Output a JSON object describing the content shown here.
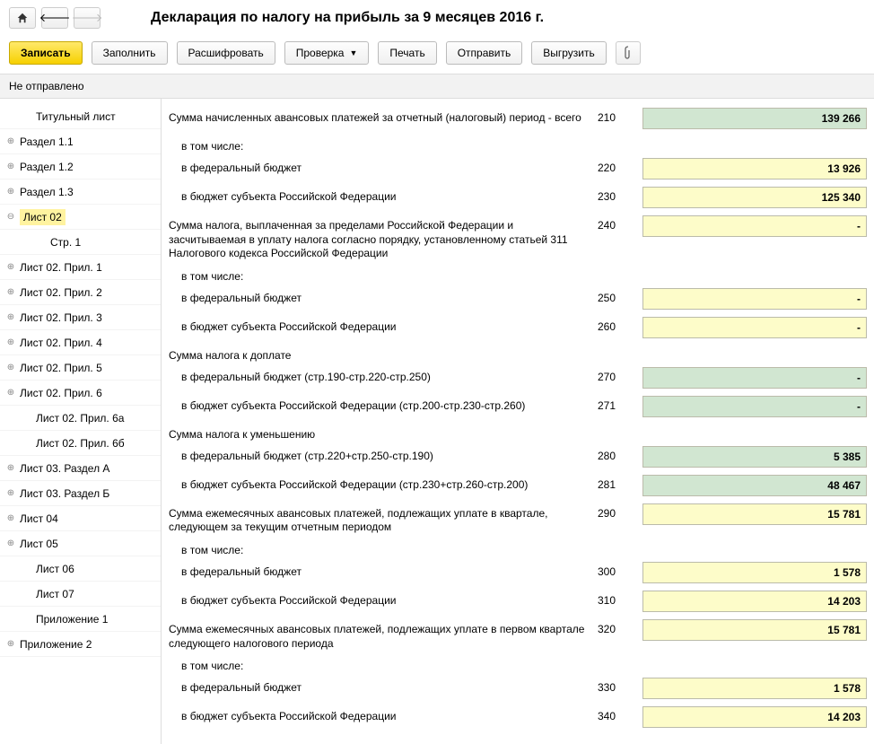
{
  "header": {
    "title": "Декларация по налогу на прибыль за 9 месяцев 2016 г."
  },
  "toolbar": {
    "save": "Записать",
    "fill": "Заполнить",
    "decode": "Расшифровать",
    "check": "Проверка",
    "print": "Печать",
    "send": "Отправить",
    "export": "Выгрузить"
  },
  "status": "Не отправлено",
  "sidebar": [
    {
      "label": "Титульный лист",
      "lvl": 1,
      "exp": ""
    },
    {
      "label": "Раздел 1.1",
      "lvl": 0,
      "exp": "+"
    },
    {
      "label": "Раздел 1.2",
      "lvl": 0,
      "exp": "+"
    },
    {
      "label": "Раздел 1.3",
      "lvl": 0,
      "exp": "+"
    },
    {
      "label": "Лист 02",
      "lvl": 0,
      "exp": "−",
      "selected": true
    },
    {
      "label": "Стр. 1",
      "lvl": 2,
      "exp": ""
    },
    {
      "label": "Лист 02. Прил. 1",
      "lvl": 0,
      "exp": "+"
    },
    {
      "label": "Лист 02. Прил. 2",
      "lvl": 0,
      "exp": "+"
    },
    {
      "label": "Лист 02. Прил. 3",
      "lvl": 0,
      "exp": "+"
    },
    {
      "label": "Лист 02. Прил. 4",
      "lvl": 0,
      "exp": "+"
    },
    {
      "label": "Лист 02. Прил. 5",
      "lvl": 0,
      "exp": "+"
    },
    {
      "label": "Лист 02. Прил. 6",
      "lvl": 0,
      "exp": "+"
    },
    {
      "label": "Лист 02. Прил. 6а",
      "lvl": 1,
      "exp": ""
    },
    {
      "label": "Лист 02. Прил. 6б",
      "lvl": 1,
      "exp": ""
    },
    {
      "label": "Лист 03. Раздел А",
      "lvl": 0,
      "exp": "+"
    },
    {
      "label": "Лист 03. Раздел Б",
      "lvl": 0,
      "exp": "+"
    },
    {
      "label": "Лист 04",
      "lvl": 0,
      "exp": "+"
    },
    {
      "label": "Лист 05",
      "lvl": 0,
      "exp": "+"
    },
    {
      "label": "Лист 06",
      "lvl": 1,
      "exp": ""
    },
    {
      "label": "Лист 07",
      "lvl": 1,
      "exp": ""
    },
    {
      "label": "Приложение 1",
      "lvl": 1,
      "exp": ""
    },
    {
      "label": "Приложение 2",
      "lvl": 0,
      "exp": "+"
    }
  ],
  "rows": [
    {
      "desc": "Сумма начисленных авансовых платежей за отчетный (налоговый) период - всего",
      "code": "210",
      "value": "139 266",
      "cls": "green"
    },
    {
      "desc": "в том числе:",
      "indent": true,
      "section": true
    },
    {
      "desc": "в федеральный бюджет",
      "indent": true,
      "code": "220",
      "value": "13 926",
      "cls": "yellow"
    },
    {
      "desc": "в бюджет субъекта Российской Федерации",
      "indent": true,
      "code": "230",
      "value": "125 340",
      "cls": "yellow"
    },
    {
      "desc": "Сумма налога, выплаченная за пределами Российской Федерации и засчитываемая в уплату налога согласно порядку, установленному статьей 311 Налогового кодекса Российской Федерации",
      "code": "240",
      "value": "-",
      "cls": "yellow"
    },
    {
      "desc": "в том числе:",
      "indent": true,
      "section": true
    },
    {
      "desc": "в федеральный бюджет",
      "indent": true,
      "code": "250",
      "value": "-",
      "cls": "yellow"
    },
    {
      "desc": "в бюджет субъекта Российской Федерации",
      "indent": true,
      "code": "260",
      "value": "-",
      "cls": "yellow"
    },
    {
      "desc": "Сумма налога к доплате",
      "section": true
    },
    {
      "desc": "в федеральный бюджет (стр.190-стр.220-стр.250)",
      "indent": true,
      "code": "270",
      "value": "-",
      "cls": "green"
    },
    {
      "desc": "в бюджет субъекта Российской Федерации (стр.200-стр.230-стр.260)",
      "indent": true,
      "code": "271",
      "value": "-",
      "cls": "green"
    },
    {
      "desc": "Сумма налога к уменьшению",
      "section": true
    },
    {
      "desc": "в федеральный бюджет (стр.220+стр.250-стр.190)",
      "indent": true,
      "code": "280",
      "value": "5 385",
      "cls": "green"
    },
    {
      "desc": "в бюджет субъекта Российской Федерации (стр.230+стр.260-стр.200)",
      "indent": true,
      "code": "281",
      "value": "48 467",
      "cls": "green"
    },
    {
      "desc": "Сумма ежемесячных авансовых платежей, подлежащих уплате в квартале, следующем за текущим отчетным периодом",
      "code": "290",
      "value": "15 781",
      "cls": "yellow"
    },
    {
      "desc": "в том числе:",
      "indent": true,
      "section": true
    },
    {
      "desc": "в федеральный бюджет",
      "indent": true,
      "code": "300",
      "value": "1 578",
      "cls": "yellow"
    },
    {
      "desc": "в бюджет субъекта Российской Федерации",
      "indent": true,
      "code": "310",
      "value": "14 203",
      "cls": "yellow"
    },
    {
      "desc": "Сумма ежемесячных авансовых платежей, подлежащих уплате в первом квартале следующего налогового периода",
      "code": "320",
      "value": "15 781",
      "cls": "yellow"
    },
    {
      "desc": "в том числе:",
      "indent": true,
      "section": true
    },
    {
      "desc": "в федеральный бюджет",
      "indent": true,
      "code": "330",
      "value": "1 578",
      "cls": "yellow"
    },
    {
      "desc": "в бюджет субъекта Российской Федерации",
      "indent": true,
      "code": "340",
      "value": "14 203",
      "cls": "yellow"
    }
  ]
}
